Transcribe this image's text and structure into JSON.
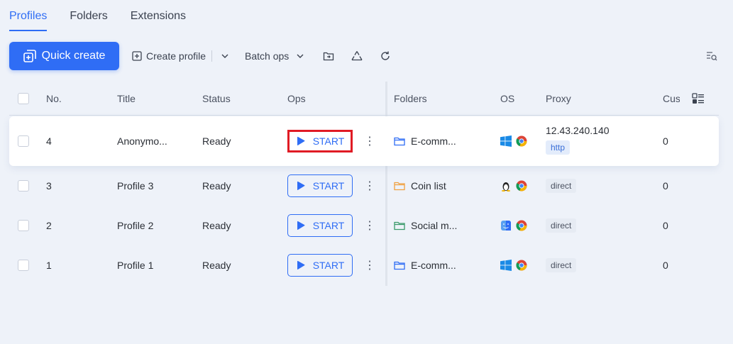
{
  "tabs": [
    {
      "label": "Profiles",
      "active": true
    },
    {
      "label": "Folders",
      "active": false
    },
    {
      "label": "Extensions",
      "active": false
    }
  ],
  "toolbar": {
    "quick_create_label": "Quick create",
    "create_profile_label": "Create profile",
    "batch_ops_label": "Batch ops"
  },
  "table": {
    "columns": [
      "No.",
      "Title",
      "Status",
      "Ops",
      "Folders",
      "OS",
      "Proxy",
      "Cus"
    ],
    "start_label": "START",
    "rows": [
      {
        "no": "4",
        "title": "Anonymo...",
        "status": "Ready",
        "folder": "E-comm...",
        "folder_color": "#2f6df5",
        "os": "windows-icon",
        "proxy_ip": "12.43.240.140",
        "proxy_type": "http",
        "cus": "0"
      },
      {
        "no": "3",
        "title": "Profile 3",
        "status": "Ready",
        "folder": "Coin list",
        "folder_color": "#f0a040",
        "os": "linux-icon",
        "proxy_type": "direct",
        "cus": "0"
      },
      {
        "no": "2",
        "title": "Profile 2",
        "status": "Ready",
        "folder": "Social m...",
        "folder_color": "#3a9a6a",
        "os": "macos-icon",
        "proxy_type": "direct",
        "cus": "0"
      },
      {
        "no": "1",
        "title": "Profile 1",
        "status": "Ready",
        "folder": "E-comm...",
        "folder_color": "#2f6df5",
        "os": "windows-icon",
        "proxy_type": "direct",
        "cus": "0"
      }
    ]
  },
  "colors": {
    "accent": "#2f6df5",
    "highlight": "#e01b24"
  }
}
